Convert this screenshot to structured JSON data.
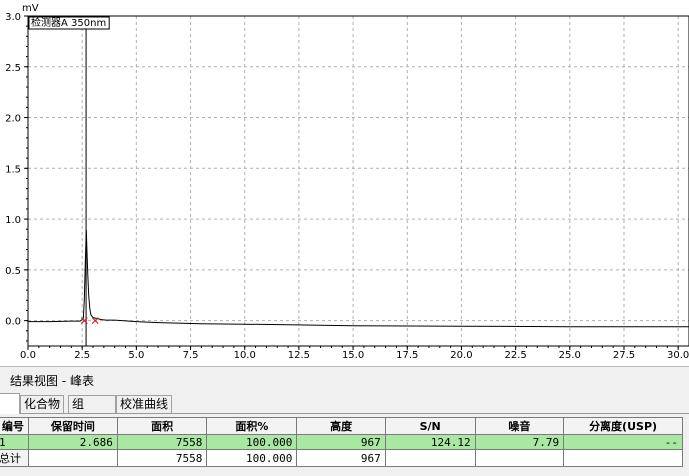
{
  "chart_data": {
    "type": "line",
    "y_unit_label": "mV",
    "legend": "检测器A 350nm",
    "xlim": [
      0.0,
      30.5
    ],
    "ylim": [
      -0.25,
      3.0
    ],
    "x_ticks": [
      "0.0",
      "2.5",
      "5.0",
      "7.5",
      "10.0",
      "12.5",
      "15.0",
      "17.5",
      "20.0",
      "22.5",
      "25.0",
      "27.5",
      "30.0"
    ],
    "y_ticks": [
      "0.0",
      "0.5",
      "1.0",
      "1.5",
      "2.0",
      "2.5",
      "3.0"
    ],
    "marker_line_x": 2.68,
    "grid": true,
    "series": [
      {
        "x": [
          0,
          1,
          2,
          2.4,
          2.55,
          2.6,
          2.65,
          2.69,
          2.72,
          2.76,
          2.8,
          2.85,
          2.9,
          3.0,
          3.1,
          3.2,
          3.4,
          3.6,
          4,
          5,
          6,
          8,
          10,
          12,
          15,
          20,
          25,
          30.5
        ],
        "y": [
          -0.01,
          -0.01,
          -0.005,
          -0.005,
          0.02,
          0.2,
          0.6,
          0.89,
          0.7,
          0.45,
          0.25,
          0.12,
          0.06,
          0.03,
          0.025,
          0.02,
          0.01,
          0.005,
          0.005,
          -0.01,
          -0.02,
          -0.03,
          -0.035,
          -0.04,
          -0.05,
          -0.055,
          -0.06,
          -0.06
        ]
      }
    ],
    "integration_marks_x": [
      2.6,
      3.1
    ]
  },
  "results": {
    "title": "结果视图 -  峰表",
    "tabs": [
      "",
      "化合物",
      "组",
      "校准曲线"
    ],
    "columns": [
      "编号",
      "保留时间",
      "面积",
      "面积%",
      "高度",
      "S/N",
      "噪音",
      "分离度(USP)"
    ],
    "rows": [
      {
        "id": "1",
        "cells": [
          "2.686",
          "7558",
          "100.000",
          "967",
          "124.12",
          "7.79",
          "--"
        ]
      },
      {
        "id": "总计",
        "cells": [
          "",
          "7558",
          "100.000",
          "967",
          "",
          "",
          ""
        ]
      }
    ]
  }
}
